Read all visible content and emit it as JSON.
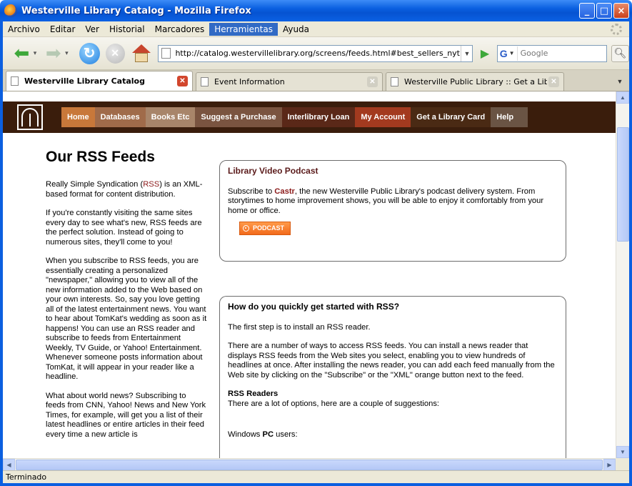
{
  "window": {
    "title": "Westerville Library Catalog - Mozilla Firefox",
    "minimize": "_",
    "maximize": "□",
    "close": "×"
  },
  "menu": {
    "items": [
      "Archivo",
      "Editar",
      "Ver",
      "Historial",
      "Marcadores",
      "Herramientas",
      "Ayuda"
    ],
    "active": "Herramientas"
  },
  "navigation": {
    "url": "http://catalog.westervillelibrary.org/screens/feeds.html#best_sellers_nyt",
    "search_placeholder": "Google",
    "search_engine_letter": "G"
  },
  "tabs": [
    {
      "label": "Westerville Library Catalog",
      "active": true
    },
    {
      "label": "Event Information",
      "active": false
    },
    {
      "label": "Westerville Public Library :: Get a Libr...",
      "active": false
    }
  ],
  "site": {
    "nav": [
      {
        "label": "Home",
        "color": "#c8783a"
      },
      {
        "label": "Databases",
        "color": "#a06b4a"
      },
      {
        "label": "Books Etc",
        "color": "#a8856a"
      },
      {
        "label": "Suggest a Purchase",
        "color": "#7a5440"
      },
      {
        "label": "Interlibrary Loan",
        "color": "#5a2818"
      },
      {
        "label": "My Account",
        "color": "#a33a1f"
      },
      {
        "label": "Get a Library Card",
        "color": "#4a2a14"
      },
      {
        "label": "Help",
        "color": "#6a5444"
      }
    ]
  },
  "page": {
    "title": "Our RSS Feeds",
    "intro_pre": "Really Simple Syndication (",
    "intro_link": "RSS",
    "intro_post": ") is an XML-based format for content distribution.",
    "para2": "If you're constantly visiting the same sites every day to see what's new, RSS feeds are the perfect solution. Instead of going to numerous sites, they'll come to you!",
    "para3": "When you subscribe to RSS feeds, you are essentially creating a personalized \"newspaper,\" allowing you to view all of the new information added to the Web based on your own interests. So, say you love getting all of the latest entertainment news. You want to hear about TomKat's wedding as soon as it happens! You can use an RSS reader and subscribe to feeds from Entertainment Weekly, TV Guide, or Yahoo! Entertainment. Whenever someone posts information about TomKat, it will appear in your reader like a headline.",
    "para4": "What about world news? Subscribing to feeds from CNN, Yahoo! News and New York Times, for example, will get you a list of their latest headlines or entire articles in their feed every time a new article is"
  },
  "podcast_box": {
    "title": "Library Video Podcast",
    "text_pre": "Subscribe to ",
    "text_link": "Castr",
    "text_post": ", the new Westerville Public Library's podcast delivery system. From storytimes to home improvement shows, you will be able to enjoy it comfortably from your home or office.",
    "button": "PODCAST"
  },
  "rss_box": {
    "title": "How do you quickly get started with RSS?",
    "p1": "The first step is to install an RSS reader.",
    "p2": "There are a number of ways to access RSS feeds. You can install a news reader that displays RSS feeds from the Web sites you select, enabling you to view hundreds of headlines at once. After installing the news reader, you can add each feed manually from the Web site by clicking on the \"Subscribe\" or the \"XML\" orange button next to the feed.",
    "readers_heading": "RSS Readers",
    "readers_text": "There are a lot of options, here are a couple of suggestions:",
    "windows_pre": "Windows ",
    "windows_bold": "PC",
    "windows_post": " users:"
  },
  "status": "Terminado"
}
